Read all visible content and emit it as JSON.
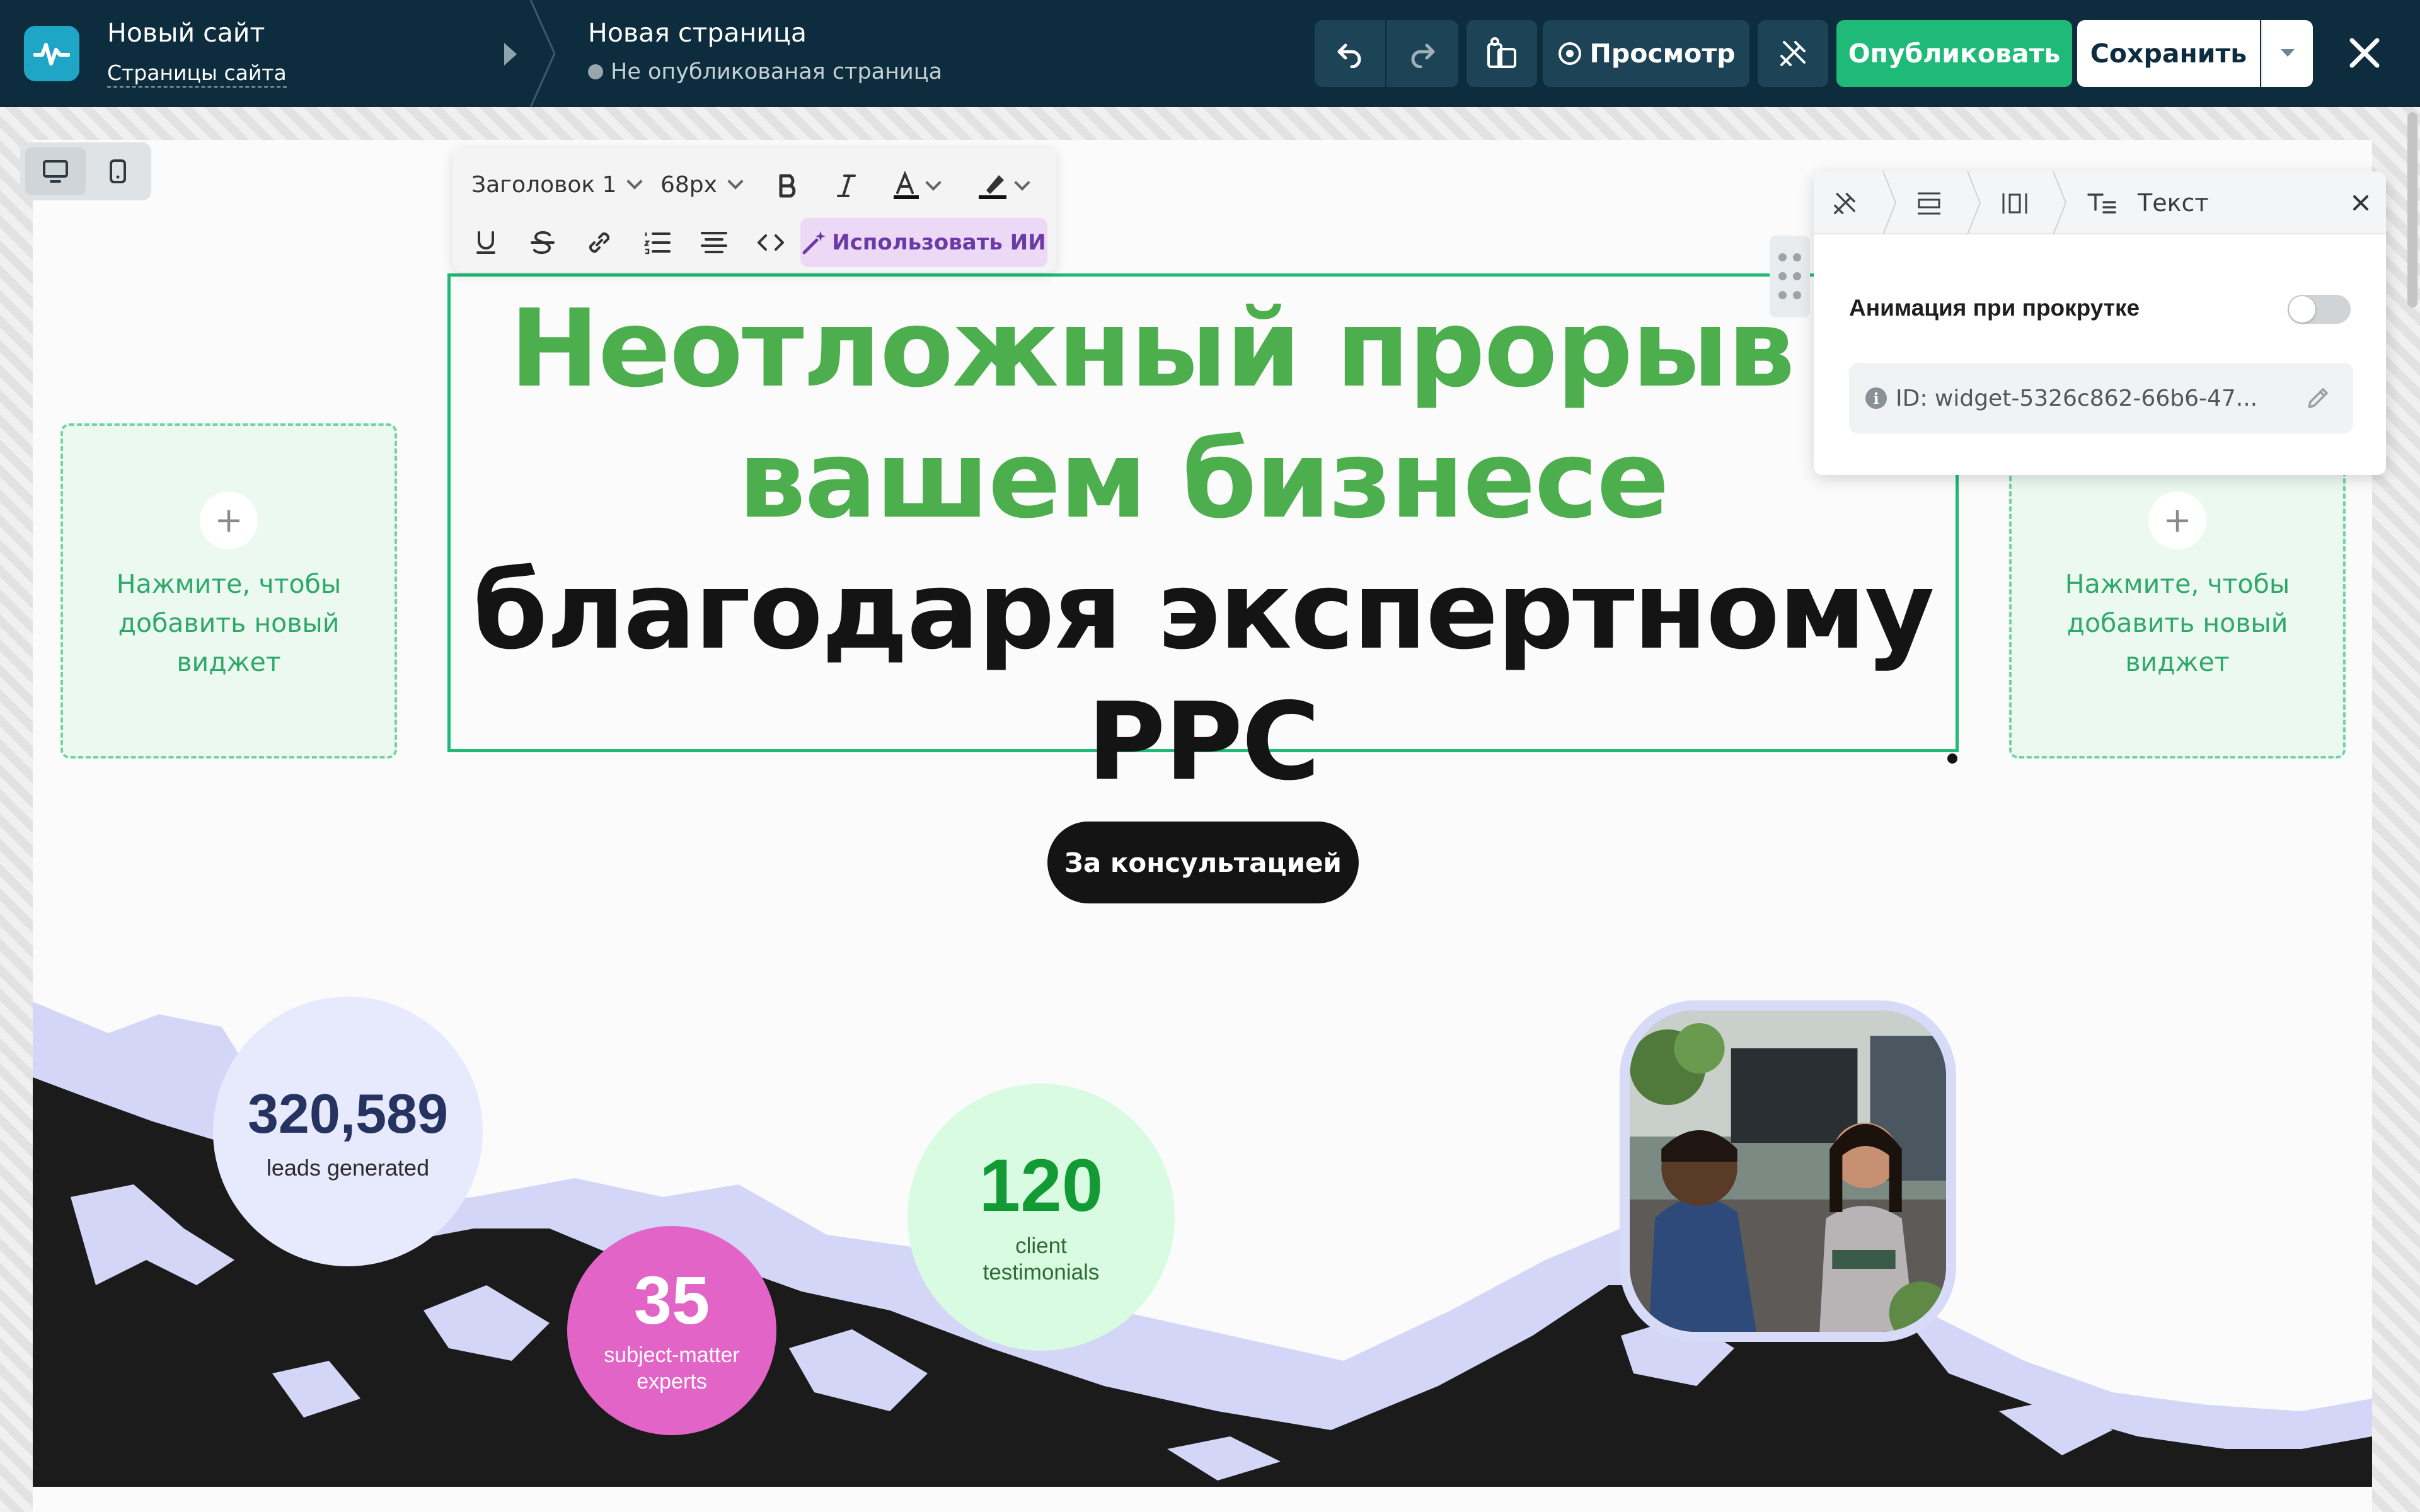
{
  "header": {
    "site_name": "Новый сайт",
    "site_pages_link": "Страницы сайта",
    "page_name": "Новая страница",
    "page_status": "Не опубликованая страница",
    "preview_label": "Просмотр",
    "publish_label": "Опубликовать",
    "save_label": "Сохранить",
    "icons": [
      "pulse-icon",
      "undo-icon",
      "redo-icon",
      "assets-icon",
      "eye-icon",
      "magic-icon",
      "chevron-down-icon",
      "close-icon"
    ]
  },
  "device_switch": {
    "icons": [
      "desktop-icon",
      "mobile-icon"
    ],
    "active": "desktop"
  },
  "text_toolbar": {
    "heading_select": "Заголовок 1",
    "size_select": "68px",
    "ai_label": "Использовать ИИ",
    "tools": [
      "bold-icon",
      "italic-icon",
      "text-color-icon",
      "highlight-icon",
      "underline-icon",
      "strikethrough-icon",
      "link-icon",
      "list-icon",
      "align-icon",
      "code-icon",
      "sparkle-icon"
    ]
  },
  "hero": {
    "headline_green": "Неотложный прорыв в вашем бизнесе",
    "headline_dark": "благодаря экспертному PPC",
    "cta_label": "За консультацией"
  },
  "placeholders": {
    "plus": "+",
    "left_text": "Нажмите, чтобы добавить новый виджет",
    "right_text": "Нажмите, чтобы добавить новый виджет"
  },
  "stats": {
    "leads_value": "320,589",
    "leads_label": "leads generated",
    "testimonials_value": "120",
    "testimonials_label": "client testimonials",
    "experts_value": "35",
    "experts_label": "subject-matter experts"
  },
  "settings_panel": {
    "title": "Текст",
    "animation_label": "Анимация при прокрутке",
    "animation_enabled": false,
    "widget_id": "ID: widget-5326c862-66b6-47...",
    "info_glyph": "i",
    "icons": [
      "design-icon",
      "layout-icon",
      "spacing-icon",
      "text-icon",
      "close-icon",
      "info-icon",
      "pencil-icon"
    ]
  },
  "colors": {
    "topbar": "#0d2d3e",
    "accent_green": "#1fb978",
    "headline_green": "#4cae4c",
    "placeholder_green": "#2fa96a"
  }
}
